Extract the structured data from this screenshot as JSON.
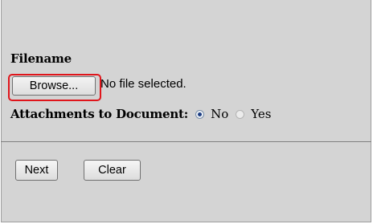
{
  "form": {
    "filename_label": "Filename",
    "browse_label": "Browse...",
    "no_file_text": "No file selected.",
    "attachments_label": "Attachments to Document:",
    "options": [
      {
        "label": "No",
        "selected": true
      },
      {
        "label": "Yes",
        "selected": false
      }
    ]
  },
  "buttons": {
    "next_label": "Next",
    "clear_label": "Clear"
  },
  "colors": {
    "background": "#d4d4d4",
    "highlight": "#e0151b"
  }
}
